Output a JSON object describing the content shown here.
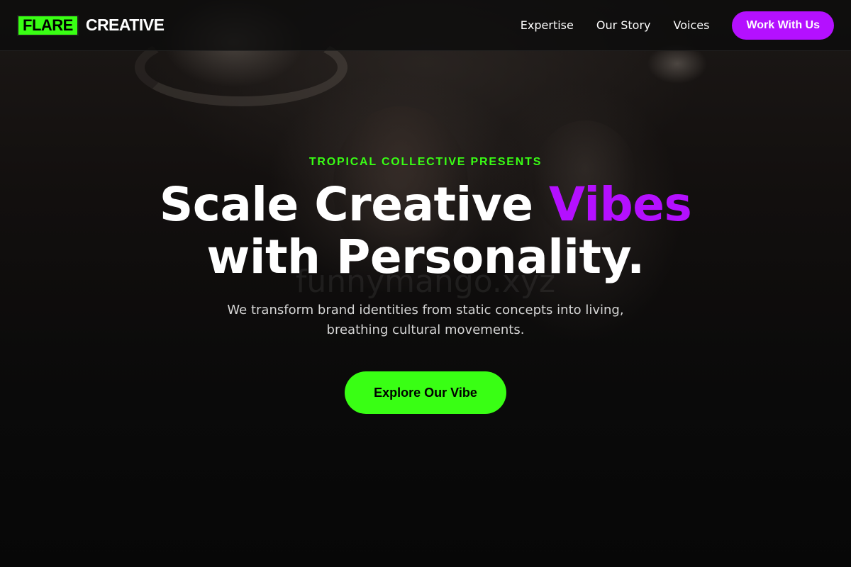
{
  "brand": {
    "mark": "FLARE",
    "name": "CREATIVE",
    "accent_green": "#39ff14",
    "accent_purple": "#b410ff"
  },
  "nav": {
    "links": [
      "Expertise",
      "Our Story",
      "Voices"
    ],
    "cta_label": "Work With Us"
  },
  "hero": {
    "eyebrow": "TROPICAL COLLECTIVE PRESENTS",
    "headline_part1": "Scale Creative ",
    "headline_accent": "Vibes",
    "headline_part2": "with Personality.",
    "watermark": "funnymango.xyz",
    "subtitle": "We transform brand identities from static concepts into living, breathing cultural movements.",
    "cta_label": "Explore Our Vibe"
  }
}
